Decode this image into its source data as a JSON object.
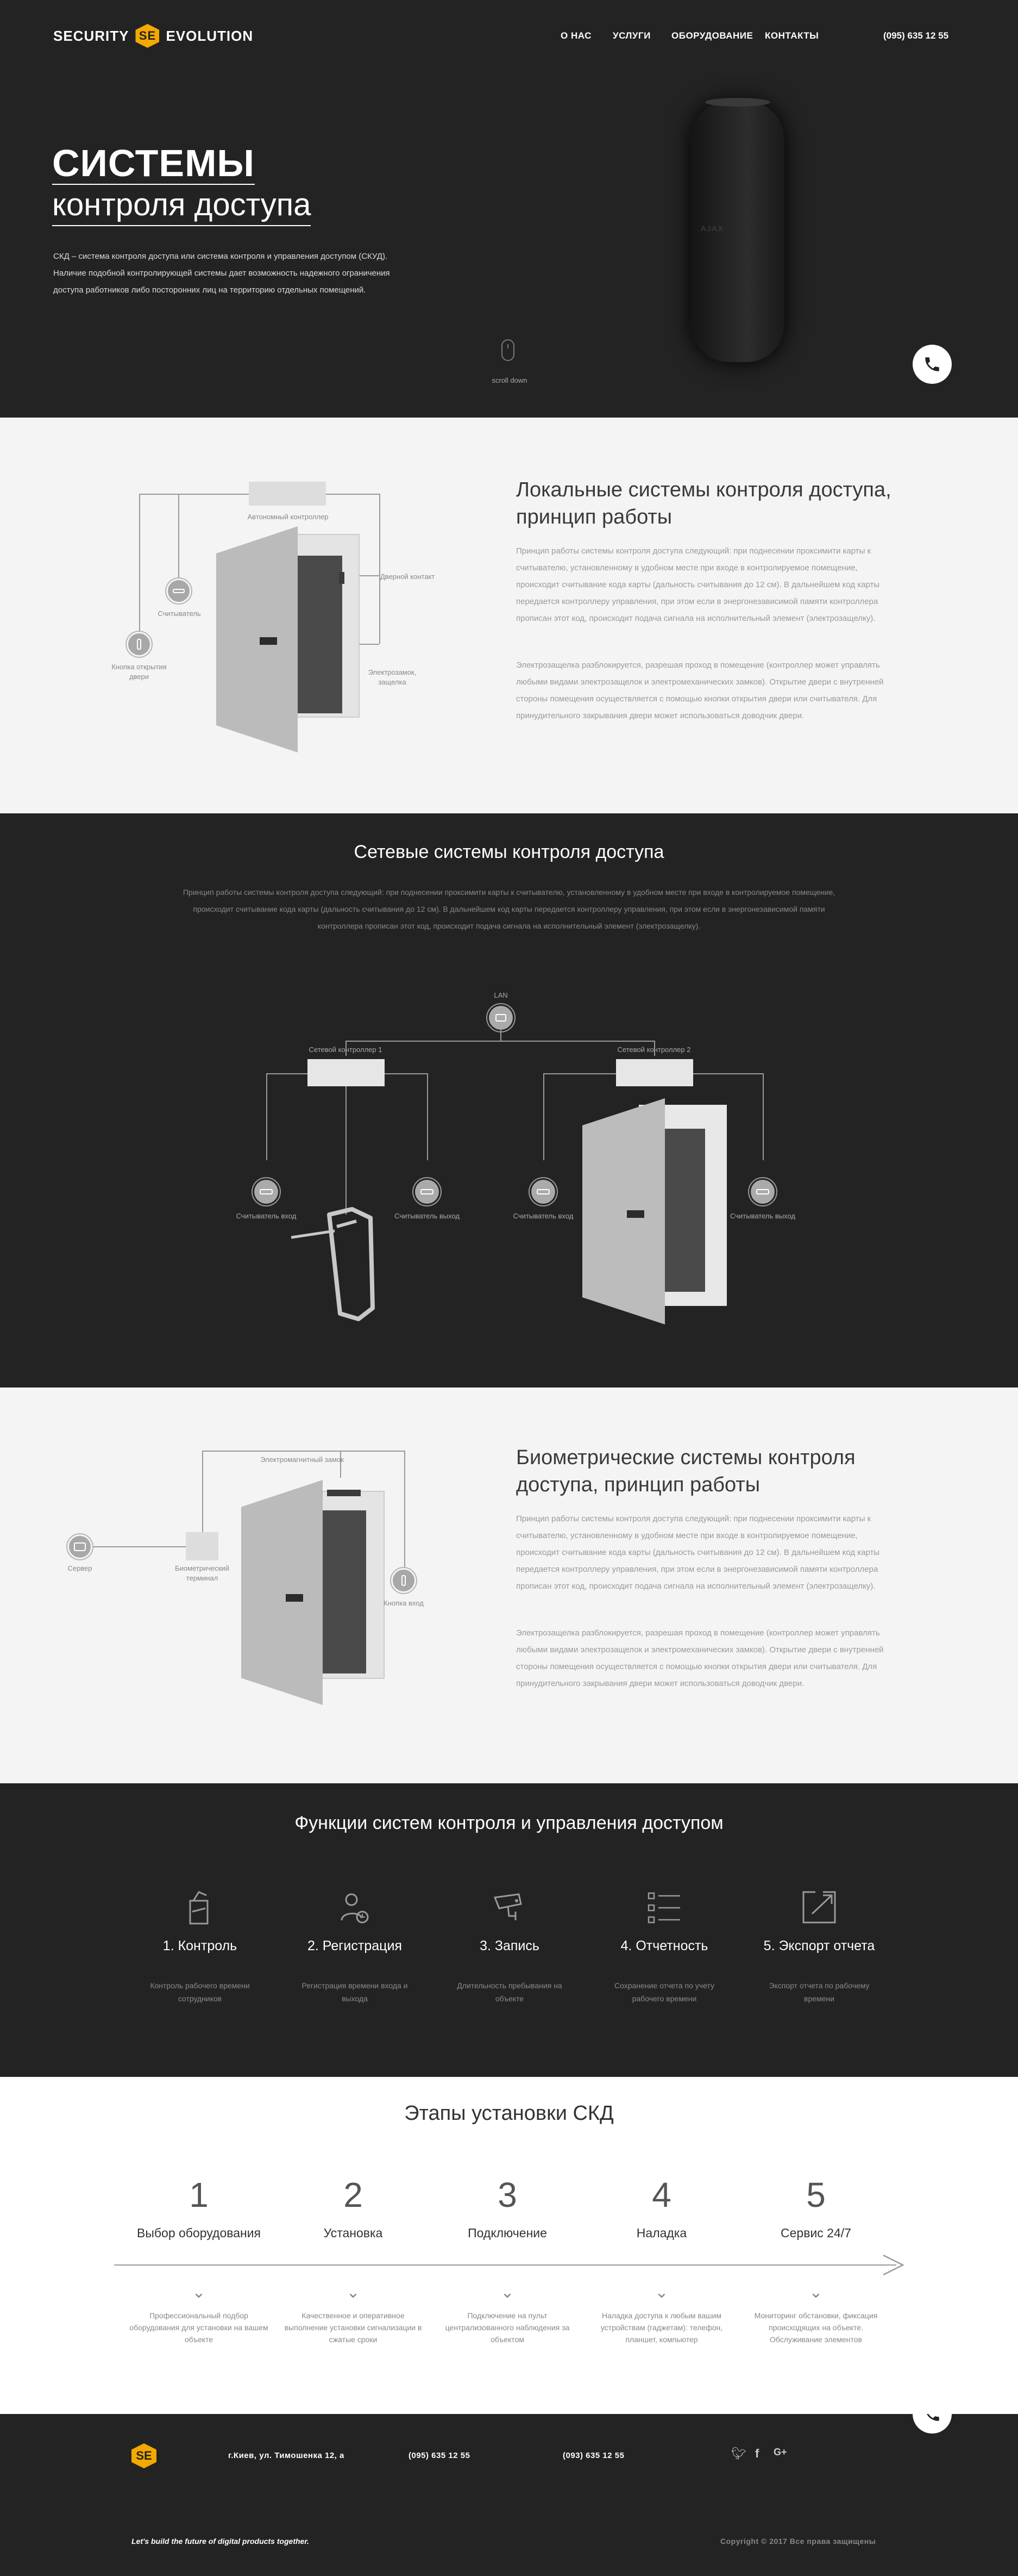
{
  "header": {
    "logo_left": "SECURITY",
    "logo_mark": "SE",
    "logo_right": "EVOLUTION",
    "nav": [
      "О НАС",
      "УСЛУГИ",
      "ОБОРУДОВАНИЕ",
      "КОНТАКТЫ"
    ],
    "phone": "(095) 635 12 55"
  },
  "hero": {
    "title_line1": "СИСТЕМЫ",
    "title_line2": "контроля доступа",
    "text": "СКД – система контроля доступа или система контроля и управления доступом (СКУД). Наличие подобной контролирующей системы дает возможность надежного ограничения доступа работников либо посторонних лиц на территорию отдельных помещений.",
    "device_label": "AJAX",
    "scroll_label": "scroll down"
  },
  "local": {
    "title": "Локальные системы контроля доступа, принцип работы",
    "p1": "Принцип работы системы контроля доступа следующий: при поднесении проксимити карты к считывателю, установленному в удобном месте при входе в контролируемое помещение, происходит считывание кода карты (дальность считывания до 12 см). В дальнейшем код карты передается контроллеру управления, при этом если в энергонезависимой памяти контроллера прописан этот код, происходит подача сигнала на исполнительный элемент (электрозащелку).",
    "p2": "Электрозащелка разблокируется, разрешая проход в помещение (контроллер может управлять любыми видами электрозащелок и электромеханических замков). Открытие двери с внутренней стороны помещения осуществляется с помощью кнопки открытия двери или считывателя. Для принудительного закрывания двери может использоваться доводчик двери.",
    "labels": {
      "controller": "Автономный контроллер",
      "reader": "Считыватель",
      "button": "Кнопка открытия двери",
      "contact": "Дверной контакт",
      "lock": "Электрозамок, защелка"
    }
  },
  "network": {
    "title": "Сетевые системы контроля доступа",
    "text": "Принцип работы системы контроля доступа следующий: при поднесении проксимити карты к считывателю, установленному в удобном месте при входе в контролируемое помещение, происходит считывание кода карты (дальность считывания до 12 см). В дальнейшем код карты передается контроллеру управления, при этом если в энергонезависимой памяти контроллера прописан этот код, происходит подача сигнала на исполнительный элемент (электрозащелку).",
    "labels": {
      "lan": "LAN",
      "ctrl1": "Сетевой контроллер 1",
      "ctrl2": "Сетевой контроллер 2",
      "r_in": "Считыватель вход",
      "r_out": "Считыватель выход"
    }
  },
  "bio": {
    "title": "Биометрические системы контроля доступа, принцип работы",
    "p1": "Принцип работы системы контроля доступа следующий: при поднесении проксимити карты к считывателю, установленному в удобном месте при входе в контролируемое помещение, происходит считывание кода карты (дальность считывания до 12 см). В дальнейшем код карты передается контроллеру управления, при этом если в энергонезависимой памяти контроллера прописан этот код, происходит подача сигнала на исполнительный элемент (электрозащелку).",
    "p2": "Электрозащелка разблокируется, разрешая проход в помещение (контроллер может управлять любыми видами электрозащелок и электромеханических замков). Открытие двери с внутренней стороны помещения осуществляется с помощью кнопки открытия двери или считывателя. Для принудительного закрывания двери может использоваться доводчик двери.",
    "labels": {
      "lock": "Электромагнитный замок",
      "server": "Сервер",
      "terminal": "Биометрический терминал",
      "button": "Кнопка вход"
    }
  },
  "functions": {
    "title": "Функции систем контроля и управления доступом",
    "items": [
      {
        "title": "1. Контроль",
        "desc": "Контроль рабочего времени сотрудников",
        "icon": "turnstile-icon"
      },
      {
        "title": "2. Регистрация",
        "desc": "Регистрация времени входа и выхода",
        "icon": "user-clock-icon"
      },
      {
        "title": "3. Запись",
        "desc": "Длительность пребывания на объекте",
        "icon": "camera-icon"
      },
      {
        "title": "4. Отчетность",
        "desc": "Сохранение отчета по учету рабочего времени",
        "icon": "list-icon"
      },
      {
        "title": "5. Экспорт отчета",
        "desc": "Экспорт отчета по рабочему времени",
        "icon": "export-icon"
      }
    ]
  },
  "stages": {
    "title": "Этапы установки СКД",
    "items": [
      {
        "num": "1",
        "title": "Выбор оборудования",
        "desc": "Профессиональный подбор оборудования для установки на вашем объекте"
      },
      {
        "num": "2",
        "title": "Установка",
        "desc": "Качественное и оперативное выполнение установки сигнализации в сжатые сроки"
      },
      {
        "num": "3",
        "title": "Подключение",
        "desc": "Подключение на пульт централизованного наблюдения за объектом"
      },
      {
        "num": "4",
        "title": "Наладка",
        "desc": "Наладка доступа к любым вашим устройствам (гаджетам): телефон, планшет, компьютер"
      },
      {
        "num": "5",
        "title": "Сервис 24/7",
        "desc": "Мониторинг обстановки, фиксация происходящих на объекте. Обслуживание элементов"
      }
    ]
  },
  "footer": {
    "address": "г.Киев, ул. Тимошенка 12, а",
    "phone1": "(095) 635 12 55",
    "phone2": "(093) 635 12 55",
    "slogan": "Let's build the future of digital products together.",
    "copyright": "Copyright © 2017 Все права защищены"
  }
}
